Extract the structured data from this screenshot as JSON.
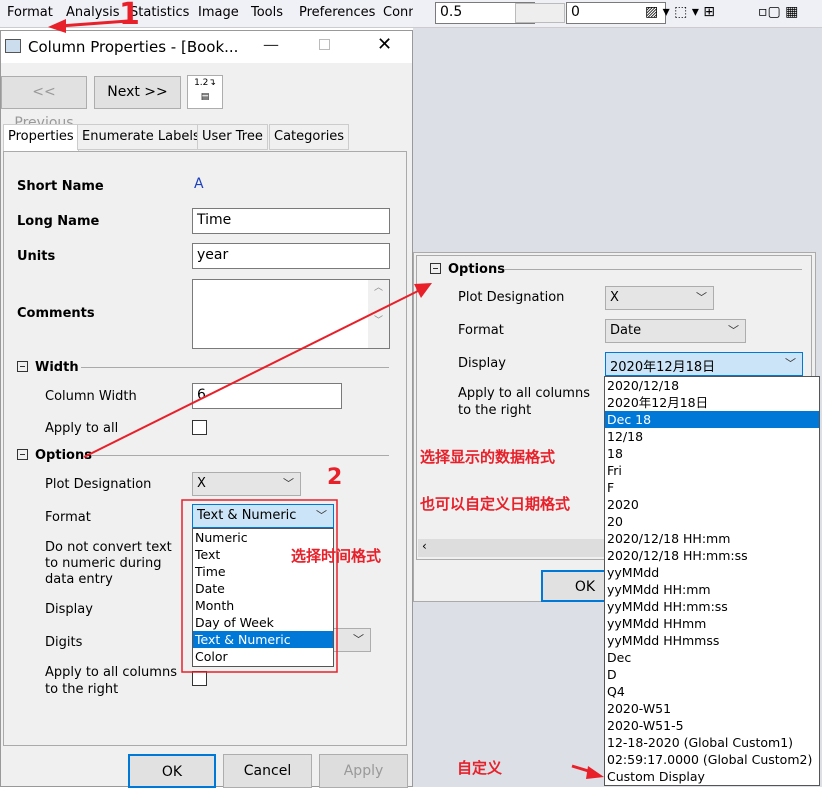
{
  "menubar": {
    "items": [
      "Format",
      "Analysis",
      "Statistics",
      "Image",
      "Tools",
      "Preferences",
      "Conn"
    ]
  },
  "toolbar": {
    "line_width": "0.5",
    "value2": "0"
  },
  "dialog": {
    "title": "Column Properties - [Book...",
    "prev": "<< Previous",
    "next": "Next >>",
    "tabs": [
      "Properties",
      "Enumerate Labels",
      "User Tree",
      "Categories"
    ],
    "short_name_label": "Short Name",
    "short_name": "A",
    "long_name_label": "Long Name",
    "long_name": "Time",
    "units_label": "Units",
    "units": "year",
    "comments_label": "Comments",
    "comments": "",
    "width_section": "Width",
    "column_width_label": "Column Width",
    "column_width": "6",
    "apply_all_label": "Apply to all",
    "options_section": "Options",
    "plot_designation_label": "Plot Designation",
    "plot_designation": "X",
    "format_label": "Format",
    "format": "Text & Numeric",
    "no_convert_label": "Do not convert text to numeric during data entry",
    "display_label": "Display",
    "digits_label": "Digits",
    "apply_right_label": "Apply to all columns to the right",
    "format_options": [
      "Numeric",
      "Text",
      "Time",
      "Date",
      "Month",
      "Day of Week",
      "Text & Numeric",
      "Color"
    ],
    "format_selected": 6,
    "ok": "OK",
    "cancel": "Cancel",
    "apply": "Apply"
  },
  "right": {
    "options_section": "Options",
    "plot_designation_label": "Plot Designation",
    "plot_designation": "X",
    "format_label": "Format",
    "format": "Date",
    "display_label": "Display",
    "display": "2020年12月18日",
    "apply_right_label": "Apply to all columns to the right",
    "ok": "OK",
    "display_options": [
      "2020/12/18",
      "2020年12月18日",
      "Dec 18",
      "12/18",
      "18",
      "Fri",
      "F",
      "2020",
      "20",
      "2020/12/18 HH:mm",
      "2020/12/18 HH:mm:ss",
      "yyMMdd",
      "yyMMdd HH:mm",
      "yyMMdd HH:mm:ss",
      "yyMMdd HHmm",
      "yyMMdd HHmmss",
      "Dec",
      "D",
      "Q4",
      "2020-W51",
      "2020-W51-5",
      "12-18-2020 (Global Custom1)",
      "02:59:17.0000 (Global Custom2)",
      "Custom Display"
    ],
    "display_selected": 2
  },
  "annotations": {
    "step1": "1",
    "step2": "2",
    "choose_time_format": "选择时间格式",
    "choose_display": "选择显示的数据格式",
    "custom_date": "也可以自定义日期格式",
    "custom": "自定义"
  },
  "colors": {
    "accent": "#0078d7",
    "annotation": "#e8202a"
  }
}
